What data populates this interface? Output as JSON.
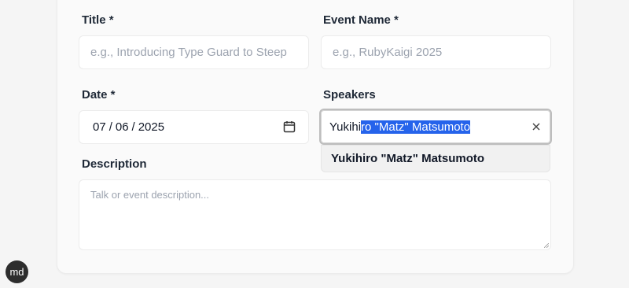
{
  "form": {
    "title_label": "Title *",
    "title_placeholder": "e.g., Introducing Type Guard to Steep",
    "event_label": "Event Name *",
    "event_placeholder": "e.g., RubyKaigi 2025",
    "date_label": "Date *",
    "date_month": "07",
    "date_day": "06",
    "date_year": "2025",
    "date_separator": "/",
    "speakers_label": "Speakers",
    "speakers_value_unselected": "Yukihi",
    "speakers_value_selected": "ro \"Matz\" Matsumoto",
    "speakers_suggestion": "Yukihiro \"Matz\" Matsumoto",
    "description_label": "Description",
    "description_placeholder": "Talk or event description..."
  },
  "icons": {
    "calendar": "calendar-icon",
    "clear": "close-icon",
    "resize": "resize-handle-icon"
  },
  "avatar": {
    "initials": "md"
  },
  "colors": {
    "selection": "#2563eb",
    "card_bg": "#fafafa",
    "page_bg": "#f5f5f5"
  }
}
